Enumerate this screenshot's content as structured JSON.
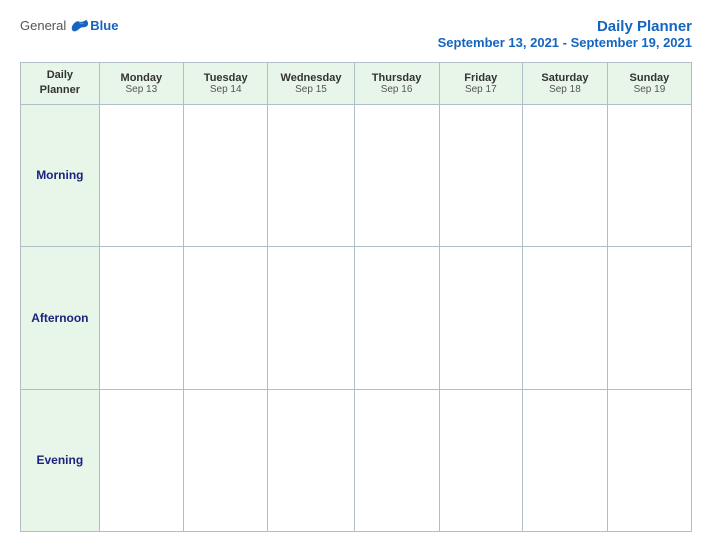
{
  "header": {
    "logo": {
      "general": "General",
      "blue": "Blue",
      "bird_unicode": "🐦"
    },
    "title": "Daily Planner",
    "date_range": "September 13, 2021 - September 19, 2021"
  },
  "table": {
    "columns": [
      {
        "day": "Daily",
        "day2": "Planner",
        "date": ""
      },
      {
        "day": "Monday",
        "date": "Sep 13"
      },
      {
        "day": "Tuesday",
        "date": "Sep 14"
      },
      {
        "day": "Wednesday",
        "date": "Sep 15"
      },
      {
        "day": "Thursday",
        "date": "Sep 16"
      },
      {
        "day": "Friday",
        "date": "Sep 17"
      },
      {
        "day": "Saturday",
        "date": "Sep 18"
      },
      {
        "day": "Sunday",
        "date": "Sep 19"
      }
    ],
    "rows": [
      {
        "label": "Morning"
      },
      {
        "label": "Afternoon"
      },
      {
        "label": "Evening"
      }
    ]
  }
}
